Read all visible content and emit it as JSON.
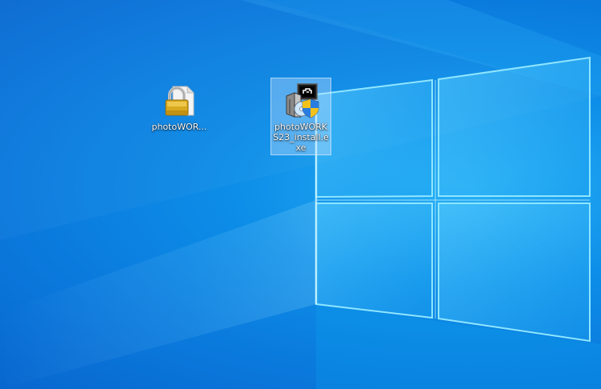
{
  "desktop": {
    "background_color": "#0a78dc",
    "glow_color": "#6fd8ff",
    "icons": [
      {
        "label": "photoWOR...",
        "icon": "locked-file-icon",
        "selected": false
      },
      {
        "label": "photoWORKS23_install.exe",
        "icon": "installer-shield-icon",
        "selected": true
      }
    ]
  }
}
